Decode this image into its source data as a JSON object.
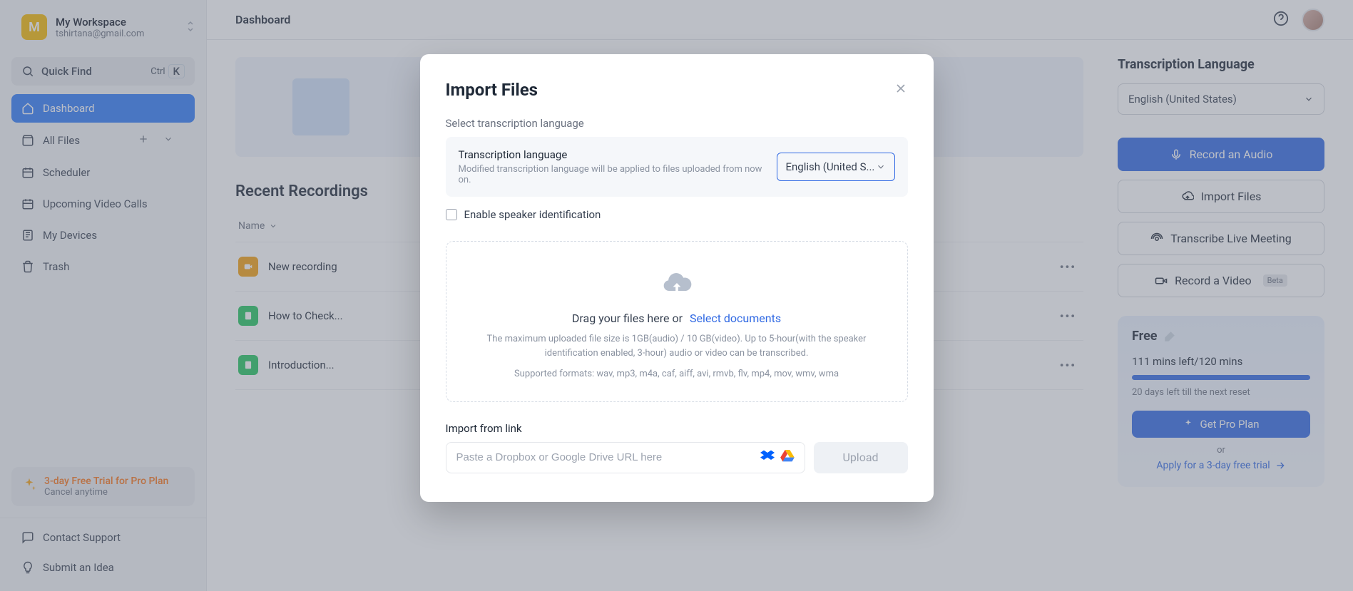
{
  "workspace": {
    "initial": "M",
    "name": "My Workspace",
    "email": "tshirtana@gmail.com"
  },
  "quickfind": {
    "label": "Quick Find",
    "shortcut_mod": "Ctrl",
    "shortcut_key": "K"
  },
  "nav": {
    "dashboard": "Dashboard",
    "allfiles": "All Files",
    "scheduler": "Scheduler",
    "upcoming": "Upcoming Video Calls",
    "devices": "My Devices",
    "trash": "Trash"
  },
  "trial": {
    "title": "3-day Free Trial for Pro Plan",
    "sub": "Cancel anytime"
  },
  "bottom": {
    "contact": "Contact Support",
    "idea": "Submit an Idea"
  },
  "topbar": {
    "crumb": "Dashboard"
  },
  "recent": {
    "heading": "Recent Recordings",
    "name_col": "Name",
    "rows": [
      {
        "name": "New recording",
        "kind": "audio"
      },
      {
        "name": "How to Check...",
        "kind": "doc"
      },
      {
        "name": "Introduction...",
        "kind": "doc"
      }
    ]
  },
  "right": {
    "lang_title": "Transcription Language",
    "lang_value": "English (United States)",
    "record_audio": "Record an Audio",
    "import_files": "Import Files",
    "live_meeting": "Transcribe Live Meeting",
    "record_video": "Record a Video",
    "beta": "Beta"
  },
  "plan": {
    "name": "Free",
    "mins": "111 mins left/120 mins",
    "reset": "20 days left till the next reset",
    "cta": "Get Pro Plan",
    "or": "or",
    "apply": "Apply for a 3-day free trial"
  },
  "modal": {
    "title": "Import Files",
    "sub": "Select transcription language",
    "lang_label": "Transcription language",
    "lang_desc": "Modified transcription language will be applied to files uploaded from now on.",
    "lang_value": "English (United S...",
    "speaker_id": "Enable speaker identification",
    "drop_prefix": "Drag your files here or",
    "drop_link": "Select documents",
    "drop_meta1": "The maximum uploaded file size is 1GB(audio) / 10 GB(video). Up to 5-hour(with the speaker identification enabled, 3-hour) audio or video can be transcribed.",
    "drop_meta2": "Supported formats: wav, mp3, m4a, caf, aiff, avi, rmvb, flv, mp4, mov, wmv, wma",
    "import_link_h": "Import from link",
    "link_placeholder": "Paste a Dropbox or Google Drive URL here",
    "upload": "Upload"
  }
}
